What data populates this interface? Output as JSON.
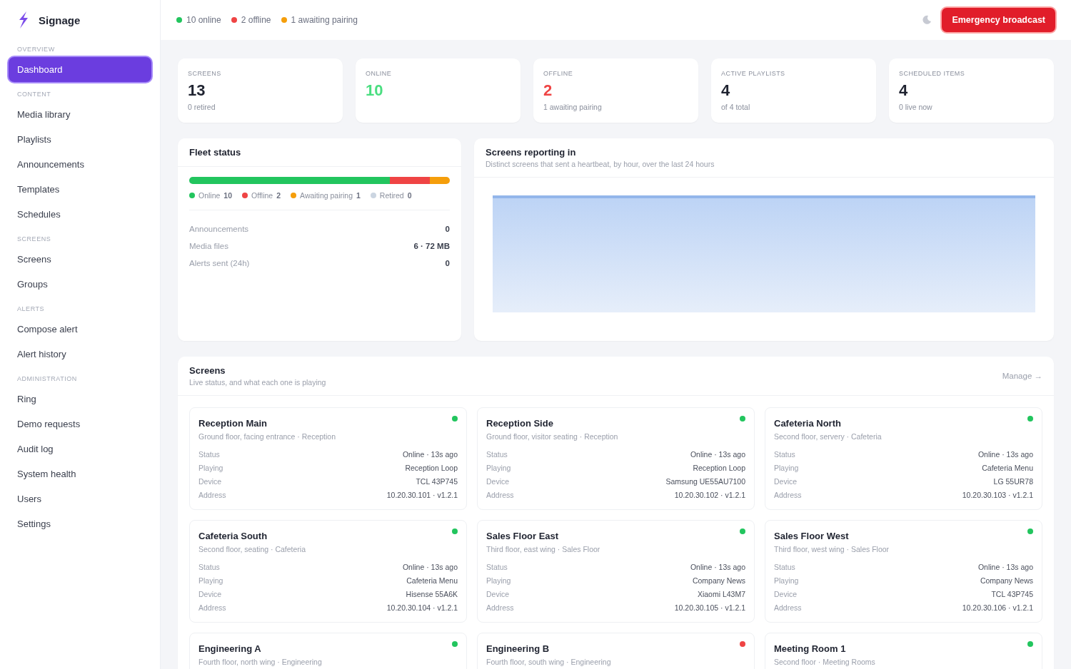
{
  "sidebar": {
    "brand": "Signage",
    "sections": [
      {
        "label": "OVERVIEW",
        "items": [
          {
            "label": "Dashboard",
            "selected": true
          }
        ]
      },
      {
        "label": "CONTENT",
        "items": [
          {
            "label": "Media library",
            "selected": false
          },
          {
            "label": "Playlists",
            "selected": false
          },
          {
            "label": "Announcements",
            "selected": false
          },
          {
            "label": "Templates",
            "selected": false
          },
          {
            "label": "Schedules",
            "selected": false
          }
        ]
      },
      {
        "label": "SCREENS",
        "items": [
          {
            "label": "Screens",
            "selected": false
          },
          {
            "label": "Groups",
            "selected": false
          }
        ]
      },
      {
        "label": "ALERTS",
        "items": [
          {
            "label": "Compose alert",
            "selected": false
          },
          {
            "label": "Alert history",
            "selected": false
          }
        ]
      },
      {
        "label": "ADMINISTRATION",
        "items": [
          {
            "label": "Ring",
            "selected": false
          },
          {
            "label": "Demo requests",
            "selected": false
          },
          {
            "label": "Audit log",
            "selected": false
          },
          {
            "label": "System health",
            "selected": false
          },
          {
            "label": "Users",
            "selected": false
          },
          {
            "label": "Settings",
            "selected": false
          }
        ]
      }
    ]
  },
  "top_bar": {
    "status": [
      {
        "text": "10 online",
        "color": "#22c55e"
      },
      {
        "text": "2 offline",
        "color": "#ef4444"
      },
      {
        "text": "1 awaiting pairing",
        "color": "#f59e0b"
      }
    ],
    "action": "Emergency broadcast"
  },
  "stats": [
    {
      "label": "SCREENS",
      "value": "13",
      "note": "0 retired",
      "kind": "plain"
    },
    {
      "label": "ONLINE",
      "value": "10",
      "kind": "good"
    },
    {
      "label": "OFFLINE",
      "value": "2",
      "note": "1 awaiting pairing",
      "kind": "bad"
    },
    {
      "label": "ACTIVE PLAYLISTS",
      "value": "4",
      "note": "of 4 total",
      "kind": "plain"
    },
    {
      "label": "SCHEDULED ITEMS",
      "value": "4",
      "note": "0 live now",
      "kind": "plain"
    }
  ],
  "fleet": {
    "title": "Fleet status",
    "legend": [
      {
        "label": "Online",
        "count": "10",
        "color": "#22c55e"
      },
      {
        "label": "Offline",
        "count": "2",
        "color": "#ef4444"
      },
      {
        "label": "Awaiting pairing",
        "count": "1",
        "color": "#f59e0b"
      },
      {
        "label": "Retired",
        "count": "0",
        "color": "#cbd5e1"
      }
    ],
    "rows": [
      {
        "label": "Announcements",
        "value": "0"
      },
      {
        "label": "Media files",
        "value": "6 · 72 MB"
      },
      {
        "label": "Alerts sent (24h)",
        "value": "0"
      }
    ]
  },
  "heartbeats": {
    "title": "Screens reporting in",
    "subtitle": "Distinct screens that sent a heartbeat, by hour, over the last 24 hours"
  },
  "screens": {
    "title": "Screens",
    "subtitle": "Live status, and what each one is playing",
    "link": "Manage →",
    "cards": [
      {
        "name": "Reception Main",
        "location": "Ground floor, facing entrance · Reception",
        "color": "#22c55e",
        "rows": [
          {
            "label": "Status",
            "value": "Online · 13s ago"
          },
          {
            "label": "Playing",
            "value": "Reception Loop"
          },
          {
            "label": "Device",
            "value": "TCL 43P745"
          },
          {
            "label": "Address",
            "value": "10.20.30.101 · v1.2.1"
          }
        ]
      },
      {
        "name": "Reception Side",
        "location": "Ground floor, visitor seating · Reception",
        "color": "#22c55e",
        "rows": [
          {
            "label": "Status",
            "value": "Online · 13s ago"
          },
          {
            "label": "Playing",
            "value": "Reception Loop"
          },
          {
            "label": "Device",
            "value": "Samsung UE55AU7100"
          },
          {
            "label": "Address",
            "value": "10.20.30.102 · v1.2.1"
          }
        ]
      },
      {
        "name": "Cafeteria North",
        "location": "Second floor, servery · Cafeteria",
        "color": "#22c55e",
        "rows": [
          {
            "label": "Status",
            "value": "Online · 13s ago"
          },
          {
            "label": "Playing",
            "value": "Cafeteria Menu"
          },
          {
            "label": "Device",
            "value": "LG 55UR78"
          },
          {
            "label": "Address",
            "value": "10.20.30.103 · v1.2.1"
          }
        ]
      },
      {
        "name": "Cafeteria South",
        "location": "Second floor, seating · Cafeteria",
        "color": "#22c55e",
        "rows": [
          {
            "label": "Status",
            "value": "Online · 13s ago"
          },
          {
            "label": "Playing",
            "value": "Cafeteria Menu"
          },
          {
            "label": "Device",
            "value": "Hisense 55A6K"
          },
          {
            "label": "Address",
            "value": "10.20.30.104 · v1.2.1"
          }
        ]
      },
      {
        "name": "Sales Floor East",
        "location": "Third floor, east wing · Sales Floor",
        "color": "#22c55e",
        "rows": [
          {
            "label": "Status",
            "value": "Online · 13s ago"
          },
          {
            "label": "Playing",
            "value": "Company News"
          },
          {
            "label": "Device",
            "value": "Xiaomi L43M7"
          },
          {
            "label": "Address",
            "value": "10.20.30.105 · v1.2.1"
          }
        ]
      },
      {
        "name": "Sales Floor West",
        "location": "Third floor, west wing · Sales Floor",
        "color": "#22c55e",
        "rows": [
          {
            "label": "Status",
            "value": "Online · 13s ago"
          },
          {
            "label": "Playing",
            "value": "Company News"
          },
          {
            "label": "Device",
            "value": "TCL 43P745"
          },
          {
            "label": "Address",
            "value": "10.20.30.106 · v1.2.1"
          }
        ]
      },
      {
        "name": "Engineering A",
        "location": "Fourth floor, north wing · Engineering",
        "color": "#22c55e"
      },
      {
        "name": "Engineering B",
        "location": "Fourth floor, south wing · Engineering",
        "color": "#ef4444"
      },
      {
        "name": "Meeting Room 1",
        "location": "Second floor · Meeting Rooms",
        "color": "#22c55e"
      }
    ]
  }
}
